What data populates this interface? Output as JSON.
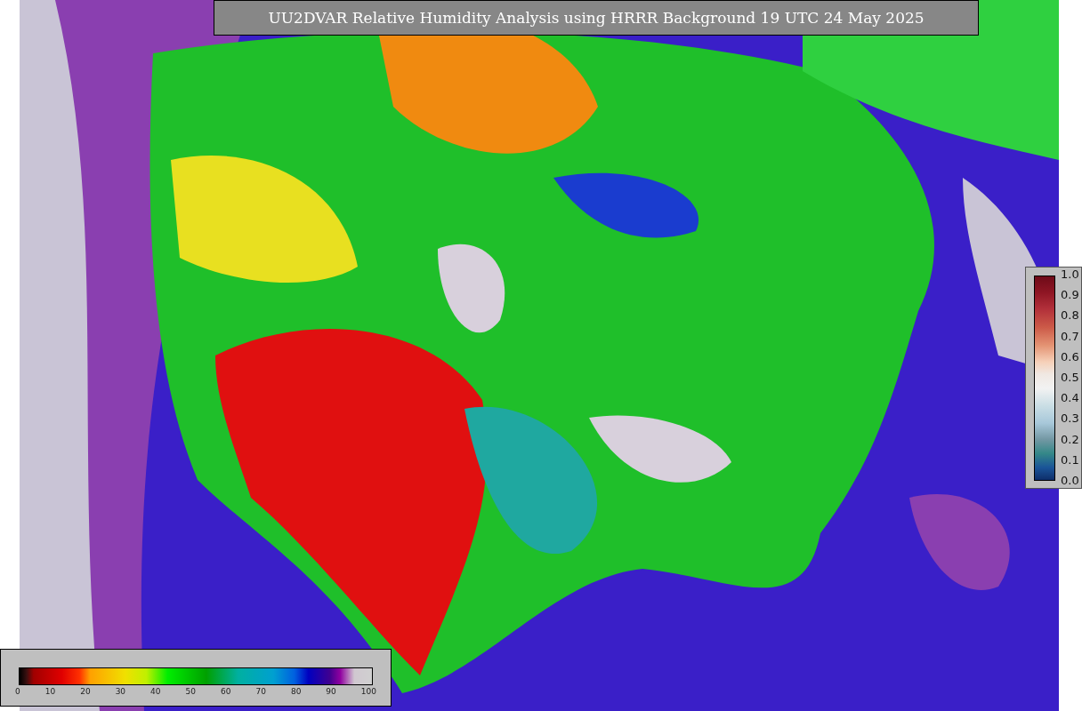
{
  "title": "UU2DVAR Relative Humidity Analysis using HRRR Background 19 UTC 24 May 2025",
  "humidity_scale": {
    "labels": [
      "0",
      "10",
      "20",
      "30",
      "40",
      "50",
      "60",
      "70",
      "80",
      "90",
      "100"
    ]
  },
  "value_scale": {
    "labels": [
      "1.0",
      "0.9",
      "0.8",
      "0.7",
      "0.6",
      "0.5",
      "0.4",
      "0.3",
      "0.2",
      "0.1",
      "0.0"
    ]
  }
}
